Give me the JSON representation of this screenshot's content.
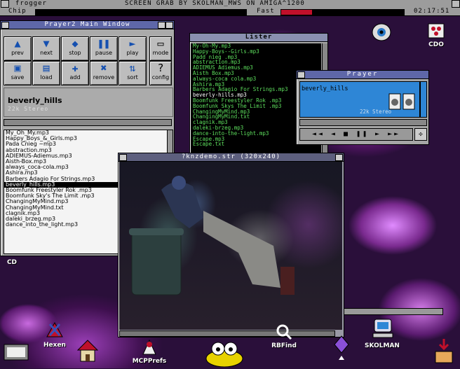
{
  "screen": {
    "app_name": "frogger",
    "title": "SCREEN GRAB BY SKOLMAN_MWS ON AMIGA^1200",
    "clock": "02:17:51",
    "chip_label": "Chip",
    "fast_label": "Fast",
    "chip_used_fraction": 0.0,
    "fast_used_fraction": 0.25,
    "colors": {
      "meter_red": "#c0102a",
      "title_active": "#5e67a8",
      "window_grey": "#aaaaaa"
    }
  },
  "player_window": {
    "title": "Prayer2 Main Window",
    "buttons_row1": [
      {
        "icon": "arrow-up-icon",
        "glyph": "▲",
        "label": "prev"
      },
      {
        "icon": "arrow-down-icon",
        "glyph": "▼",
        "label": "next"
      },
      {
        "icon": "stop-icon",
        "glyph": "◆",
        "label": "stop"
      },
      {
        "icon": "pause-icon",
        "glyph": "❚❚",
        "label": "pause"
      },
      {
        "icon": "play-icon",
        "glyph": "►",
        "label": "play"
      }
    ],
    "buttons_row2": [
      {
        "icon": "save-icon",
        "glyph": "▣",
        "label": "save"
      },
      {
        "icon": "load-icon",
        "glyph": "▤",
        "label": "load"
      },
      {
        "icon": "add-icon",
        "glyph": "✚",
        "label": "add"
      },
      {
        "icon": "remove-icon",
        "glyph": "✖",
        "label": "remove"
      },
      {
        "icon": "sort-icon",
        "glyph": "⇅",
        "label": "sort"
      }
    ],
    "mode_label": "mode",
    "config_label": "config",
    "now_playing": "beverly_hills",
    "format": "22k Stereo",
    "playlist": [
      "My_Oh_My.mp3",
      "Happy_Boys_&_Girls.mp3",
      "Pada Cnieg ~mp3",
      "abstraction.mp3",
      "ADIEMUS-Adiemus.mp3",
      "Aisth-Box.mp3",
      "always_coca-cola.mp3",
      "Ashira.mp3",
      "Barbers Adagio For Strings.mp3",
      "beverly_hills.mp3",
      "Boomfunk Freestyler Rok .mp3",
      "Boomfunk Sky's The Limit .mp3",
      "ChangingMyMind.mp3",
      "ChangingMyMind.txt",
      "clagnik.mp3",
      "daleki_brzeg.mp3",
      "dance_into_the_light.mp3"
    ],
    "selected_index": 9
  },
  "lister_window": {
    "title": "Lister",
    "files": [
      "My-Oh-My.mp3",
      "Happy-Boys--Girls.mp3",
      "Padd nieg .mp3",
      "abstraction.mp3",
      "ADIEMUS Adiemus.mp3",
      "Aisth Box.mp3",
      "always-coca cola.mp3",
      "Ashira.mp3",
      "Barbers Adagio For Strings.mp3",
      "beverly-hills.mp3",
      "Boomfunk Freestyler Rok .mp3",
      "Boomfunk Skys The Limit .mp3",
      "ChangingMyMind.mp3",
      "ChangingMyMind.txt",
      "clagnik.mp3",
      "daleki-brzeg.mp3",
      "dance-into-the-light.mp3",
      "Escape.mp3",
      "Escape.txt"
    ],
    "highlighted_index": 9
  },
  "prayer_window": {
    "title": "Prayer",
    "track": "beverly_hills",
    "format": "22k Stereo"
  },
  "video_window": {
    "title": "?knzdemo.str (320x240)"
  },
  "desktop_icons": [
    {
      "name": "hexen-icon",
      "label": "Hexen"
    },
    {
      "name": "home-icon",
      "label": ""
    },
    {
      "name": "mcpprefs-icon",
      "label": "MCPPrefs"
    },
    {
      "name": "frog-icon",
      "label": ""
    },
    {
      "name": "rbfind-icon",
      "label": "RBFind"
    },
    {
      "name": "crystal-icon",
      "label": ""
    },
    {
      "name": "skolman-icon",
      "label": "SKOLMAN"
    },
    {
      "name": "eye-icon",
      "label": ""
    },
    {
      "name": "cdo-icon",
      "label": "CDO"
    },
    {
      "name": "cd-left-label",
      "label": "CD"
    }
  ]
}
